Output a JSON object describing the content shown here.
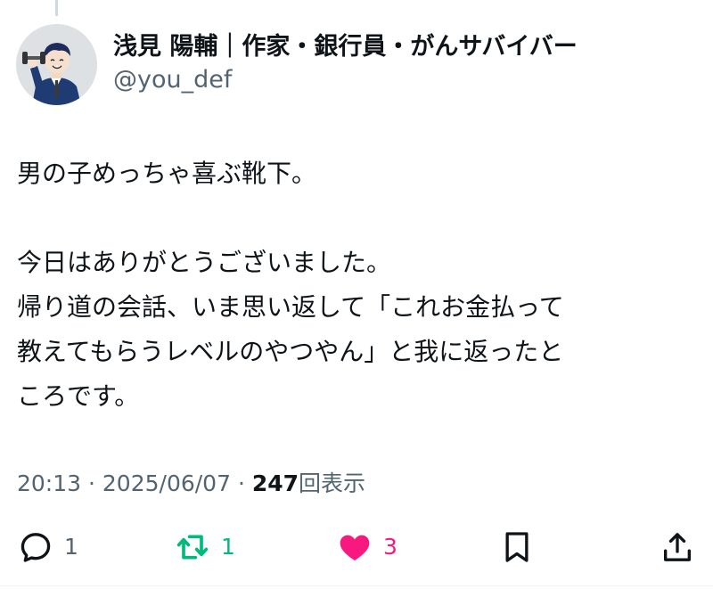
{
  "author": {
    "display_name": "浅見 陽輔｜作家・銀行員・がんサバイバー",
    "handle": "@you_def"
  },
  "tweet": {
    "lines": [
      "男の子めっちゃ喜ぶ靴下。",
      "今日はありがとうございました。",
      "帰り道の会話、いま思い返して「これお金払って",
      "教えてもらうレベルのやつやん」と我に返ったと",
      "ころです。"
    ]
  },
  "meta": {
    "time": "20:13",
    "date": "2025/06/07",
    "separator": "·",
    "views_count": "247",
    "views_label": "回表示"
  },
  "actions": {
    "reply_count": "1",
    "retweet_count": "1",
    "like_count": "3"
  },
  "icons": {
    "reply": "reply-icon",
    "retweet": "retweet-icon",
    "like": "heart-icon",
    "bookmark": "bookmark-icon",
    "share": "share-icon"
  },
  "colors": {
    "text_primary": "#0f1419",
    "text_secondary": "#536471",
    "retweet_active": "#00ba7c",
    "like_active": "#f91880"
  }
}
